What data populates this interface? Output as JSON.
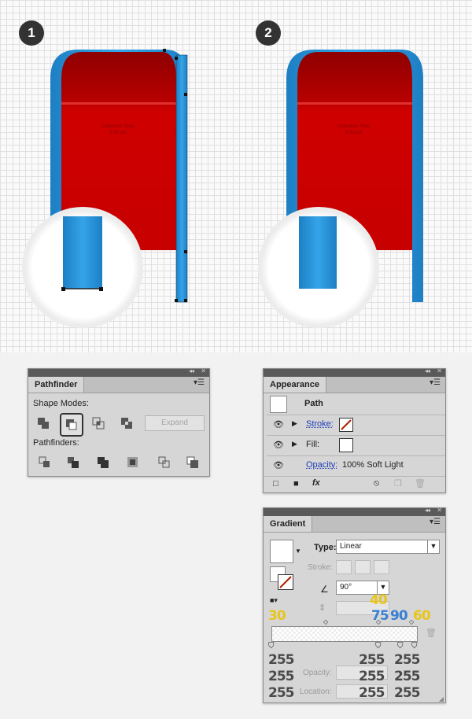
{
  "steps": {
    "one": "1",
    "two": "2"
  },
  "mailbox": {
    "label_line1": "Collection Time:",
    "label_line2": "5:30 pm",
    "colors": {
      "red": "#cc0000",
      "dark_red": "#930000",
      "blue": "#2b96dc"
    }
  },
  "pathfinder": {
    "tab": "Pathfinder",
    "shape_modes_label": "Shape Modes:",
    "expand_label": "Expand",
    "pathfinders_label": "Pathfinders:",
    "shape_mode_icons": [
      "unite-icon",
      "minus-front-icon",
      "intersect-icon",
      "exclude-icon"
    ],
    "pathfinder_icons": [
      "divide-icon",
      "trim-icon",
      "merge-icon",
      "crop-icon",
      "outline-icon",
      "minus-back-icon"
    ]
  },
  "appearance": {
    "tab": "Appearance",
    "path_label": "Path",
    "stroke_label": "Stroke:",
    "fill_label": "Fill:",
    "opacity_label": "Opacity:",
    "opacity_value": "100% Soft Light"
  },
  "gradient": {
    "tab": "Gradient",
    "type_label": "Type:",
    "type_value": "Linear",
    "stroke_label": "Stroke:",
    "angle_value": "90°",
    "opacity_label": "Opacity:",
    "location_label": "Location:"
  },
  "overlay_values": {
    "top_left": "30",
    "top_mid": "40",
    "blue_1": "75",
    "blue_2": "90",
    "top_right": "60",
    "col1": [
      "255",
      "255",
      "255"
    ],
    "col2": [
      "255",
      "255",
      "255"
    ],
    "col3": [
      "255",
      "255",
      "255"
    ]
  }
}
